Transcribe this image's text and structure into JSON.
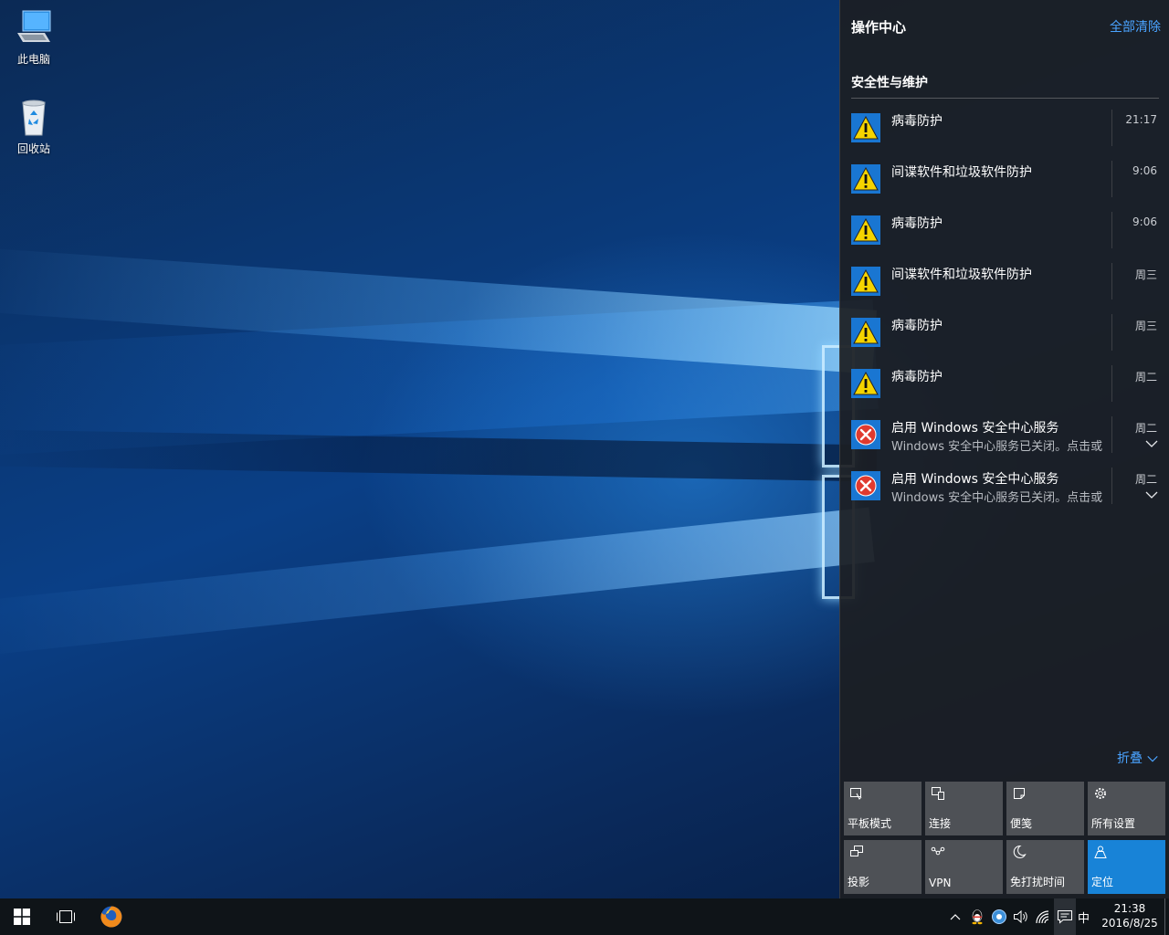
{
  "desktop": {
    "icons": [
      {
        "label": "此电脑",
        "icon": "computer-icon"
      },
      {
        "label": "回收站",
        "icon": "recycle-bin-icon"
      }
    ]
  },
  "action_center": {
    "title": "操作中心",
    "clear_all": "全部清除",
    "group_title": "安全性与维护",
    "notifications": [
      {
        "title": "病毒防护",
        "body": "",
        "time": "21:17",
        "icon": "warning-icon"
      },
      {
        "title": "间谍软件和垃圾软件防护",
        "body": "",
        "time": "9:06",
        "icon": "warning-icon"
      },
      {
        "title": "病毒防护",
        "body": "",
        "time": "9:06",
        "icon": "warning-icon"
      },
      {
        "title": "间谍软件和垃圾软件防护",
        "body": "",
        "time": "周三",
        "icon": "warning-icon"
      },
      {
        "title": "病毒防护",
        "body": "",
        "time": "周三",
        "icon": "warning-icon"
      },
      {
        "title": "病毒防护",
        "body": "",
        "time": "周二",
        "icon": "warning-icon"
      },
      {
        "title": "启用 Windows 安全中心服务",
        "body": "Windows 安全中心服务已关闭。点击或",
        "time": "周二",
        "icon": "error-icon"
      },
      {
        "title": "启用 Windows 安全中心服务",
        "body": "Windows 安全中心服务已关闭。点击或",
        "time": "周二",
        "icon": "error-icon"
      }
    ],
    "collapse_label": "折叠",
    "quick_actions": [
      {
        "label": "平板模式",
        "icon": "tablet-mode-icon",
        "active": false
      },
      {
        "label": "连接",
        "icon": "connect-icon",
        "active": false
      },
      {
        "label": "便笺",
        "icon": "note-icon",
        "active": false
      },
      {
        "label": "所有设置",
        "icon": "gear-icon",
        "active": false
      },
      {
        "label": "投影",
        "icon": "project-icon",
        "active": false
      },
      {
        "label": "VPN",
        "icon": "vpn-icon",
        "active": false
      },
      {
        "label": "免打扰时间",
        "icon": "moon-icon",
        "active": false
      },
      {
        "label": "定位",
        "icon": "location-icon",
        "active": true
      }
    ]
  },
  "taskbar": {
    "ime": "中",
    "time": "21:38",
    "date": "2016/8/25"
  },
  "colors": {
    "accent": "#1883d7",
    "link": "#4aa3ff",
    "panel_bg": "#1c1e22",
    "warning": "#f5d400",
    "error": "#e03a2f"
  }
}
